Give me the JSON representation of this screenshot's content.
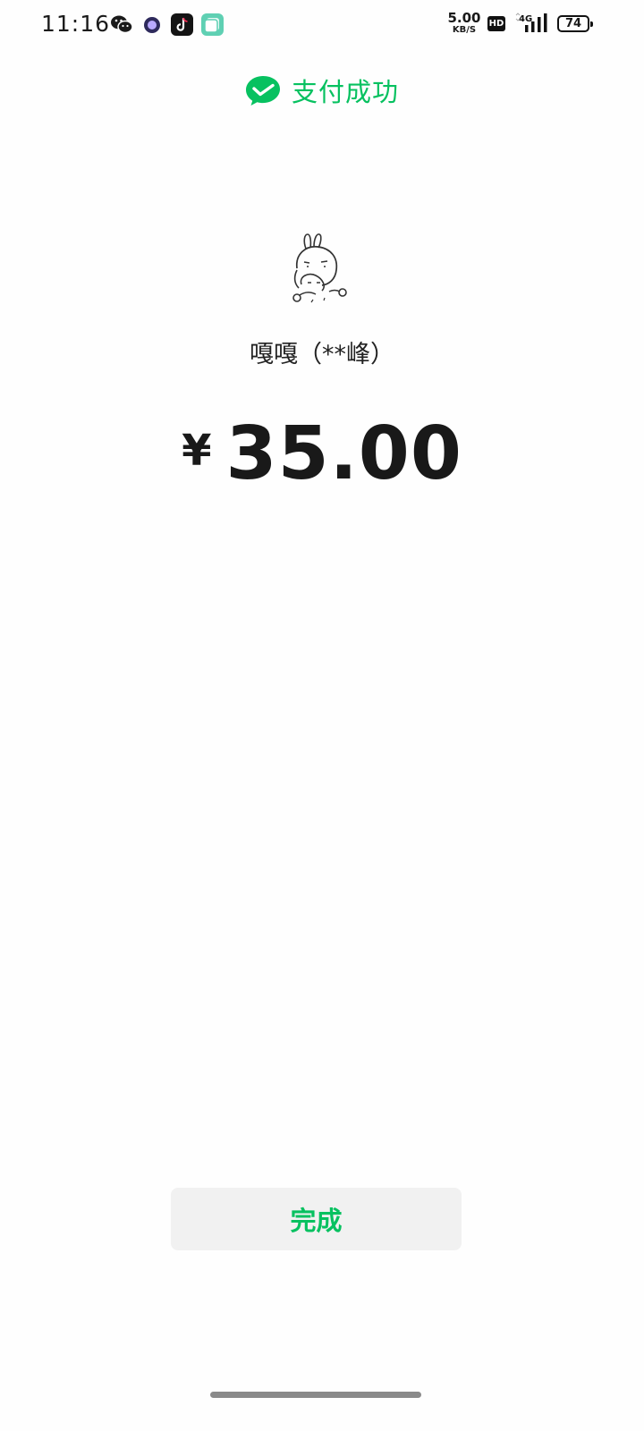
{
  "status_bar": {
    "time": "11:16",
    "network_speed_value": "5.00",
    "network_speed_unit": "KB/S",
    "hd_label": "HD",
    "network_type": "4G",
    "battery_level": "74",
    "notification_icons": [
      "wechat-icon",
      "browser-icon",
      "tiktok-icon",
      "app-icon"
    ]
  },
  "header": {
    "title": "支付成功",
    "accent_color": "#07c160"
  },
  "payee": {
    "name": "嘎嘎（**峰）"
  },
  "payment": {
    "currency_symbol": "¥",
    "amount": "35.00"
  },
  "actions": {
    "done_label": "完成"
  }
}
